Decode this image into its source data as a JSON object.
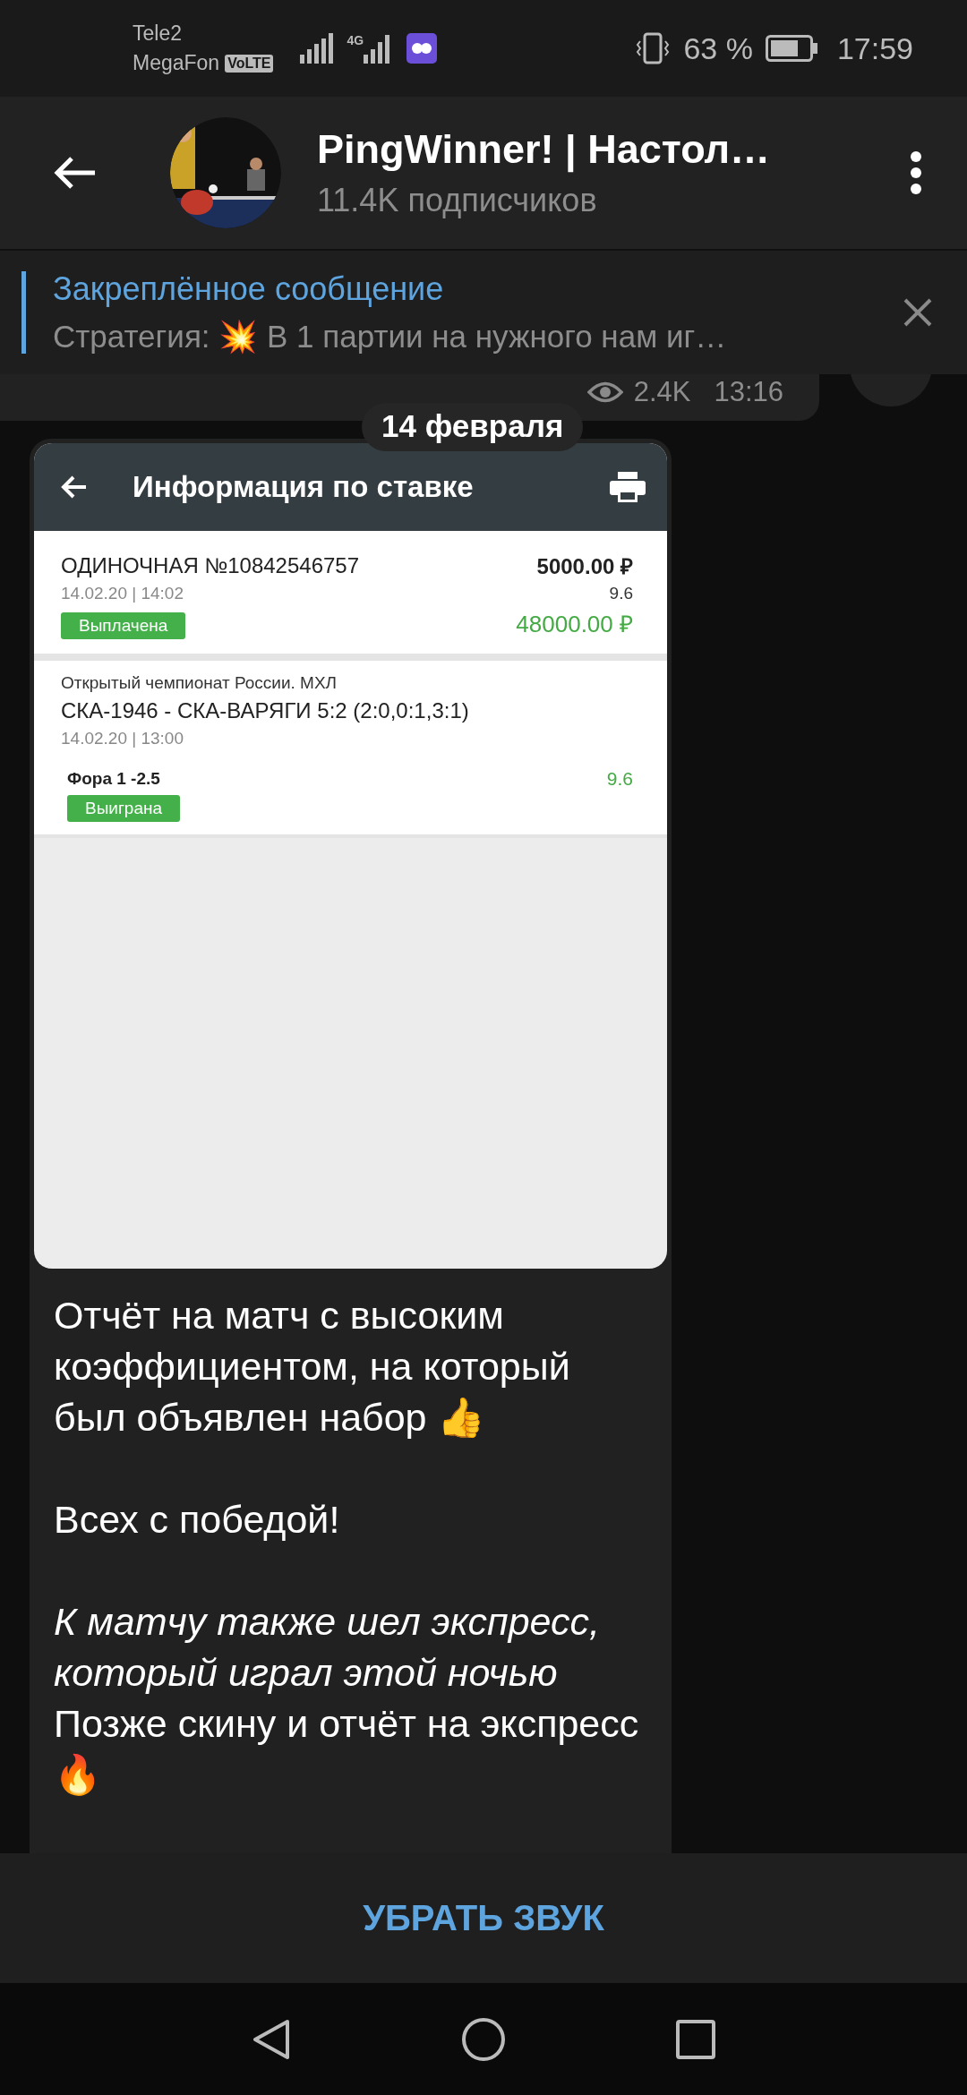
{
  "status_bar": {
    "carrier_1": "Tele2",
    "carrier_2": "MegaFon",
    "volte": "VoLTE",
    "network_type": "4G",
    "battery": "63 %",
    "time": "17:59"
  },
  "header": {
    "title": "PingWinner! | Настол…",
    "subtitle": "11.4K подписчиков"
  },
  "pinned": {
    "title": "Закреплённое сообщение",
    "text": "Стратегия: 💥  В 1 партии на нужного нам иг…"
  },
  "previous_message": {
    "views": "2.4K",
    "time": "13:16"
  },
  "date_badge": "14 февраля",
  "message": {
    "screenshot": {
      "title": "Информация по ставке",
      "bet": {
        "name": "ОДИНОЧНАЯ №10842546757",
        "datetime": "14.02.20 | 14:02",
        "status": "Выплачена",
        "stake": "5000.00 ₽",
        "odds": "9.6",
        "payout": "48000.00 ₽"
      },
      "event": {
        "league": "Открытый чемпионат России. МХЛ",
        "match": "СКА-1946 - СКА-ВАРЯГИ 5:2 (2:0,0:1,3:1)",
        "datetime": "14.02.20 | 13:00",
        "market": "Фора 1 -2.5",
        "status": "Выиграна",
        "odds": "9.6"
      }
    },
    "paragraphs": [
      "Отчёт на матч с высоким коэффициентом, на который был объявлен набор 👍",
      "Всех с победой!",
      "*К матчу также шел экспресс, который играл этой ночью*\nПозже скину и отчёт на экспресс 🔥"
    ]
  },
  "footer": {
    "mute_button": "УБРАТЬ ЗВУК"
  }
}
